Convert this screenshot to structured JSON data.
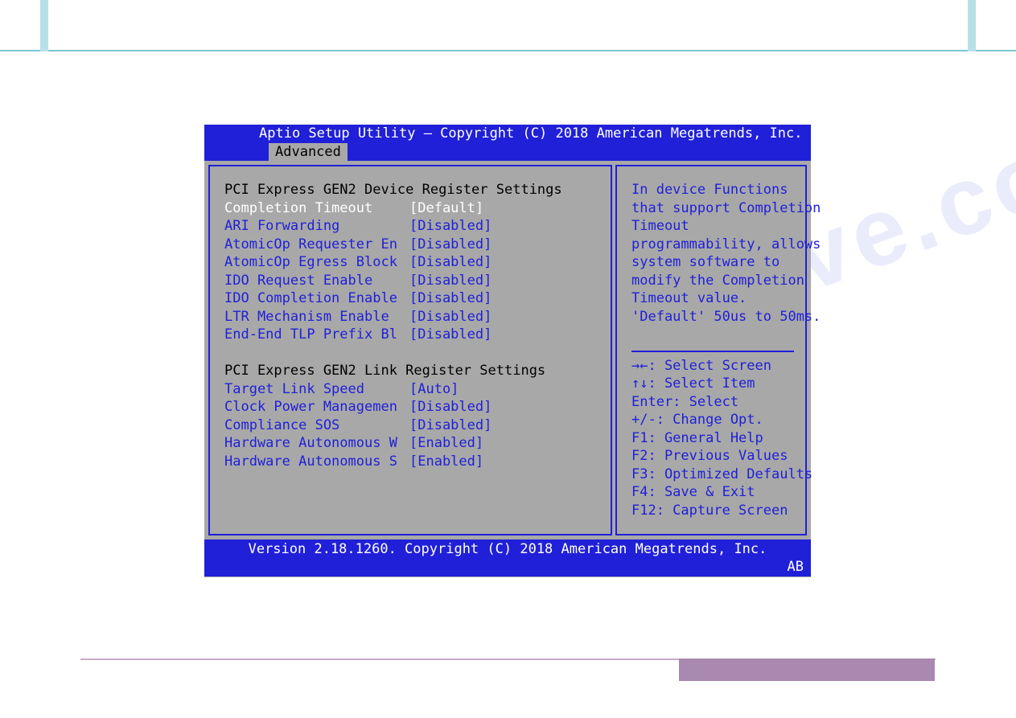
{
  "header": {
    "title": "Aptio Setup Utility – Copyright (C) 2018 American Megatrends, Inc.",
    "tab": "Advanced"
  },
  "watermark": "manualshive.com",
  "sections": {
    "device": {
      "title": "PCI Express GEN2 Device Register Settings",
      "rows": [
        {
          "label": "Completion Timeout",
          "value": "[Default]",
          "selected": true
        },
        {
          "label": "ARI Forwarding",
          "value": "[Disabled]",
          "selected": false
        },
        {
          "label": "AtomicOp Requester En",
          "value": "[Disabled]",
          "selected": false
        },
        {
          "label": "AtomicOp Egress Block",
          "value": "[Disabled]",
          "selected": false
        },
        {
          "label": "IDO Request Enable",
          "value": "[Disabled]",
          "selected": false
        },
        {
          "label": "IDO Completion Enable",
          "value": "[Disabled]",
          "selected": false
        },
        {
          "label": "LTR Mechanism Enable",
          "value": "[Disabled]",
          "selected": false
        },
        {
          "label": "End-End TLP Prefix Bl",
          "value": "[Disabled]",
          "selected": false
        }
      ]
    },
    "link": {
      "title": "PCI Express GEN2 Link Register Settings",
      "rows": [
        {
          "label": "Target Link Speed",
          "value": "[Auto]",
          "selected": false
        },
        {
          "label": "Clock Power Managemen",
          "value": "[Disabled]",
          "selected": false
        },
        {
          "label": "Compliance SOS",
          "value": "[Disabled]",
          "selected": false
        },
        {
          "label": "Hardware Autonomous W",
          "value": "[Enabled]",
          "selected": false
        },
        {
          "label": "Hardware Autonomous S",
          "value": "[Enabled]",
          "selected": false
        }
      ]
    }
  },
  "help": {
    "text": "In device Functions\nthat support Completion\nTimeout\nprogrammability, allows\nsystem software to\nmodify the Completion\nTimeout value.\n'Default' 50us to 50ms.",
    "keys": [
      "→←: Select Screen",
      "↑↓: Select Item",
      "Enter: Select",
      "+/-: Change Opt.",
      "F1: General Help",
      "F2: Previous Values",
      "F3: Optimized Defaults",
      "F4: Save & Exit",
      "F12: Capture Screen"
    ]
  },
  "footer": {
    "version": "Version 2.18.1260. Copyright (C) 2018 American Megatrends, Inc.",
    "corner": "AB"
  }
}
